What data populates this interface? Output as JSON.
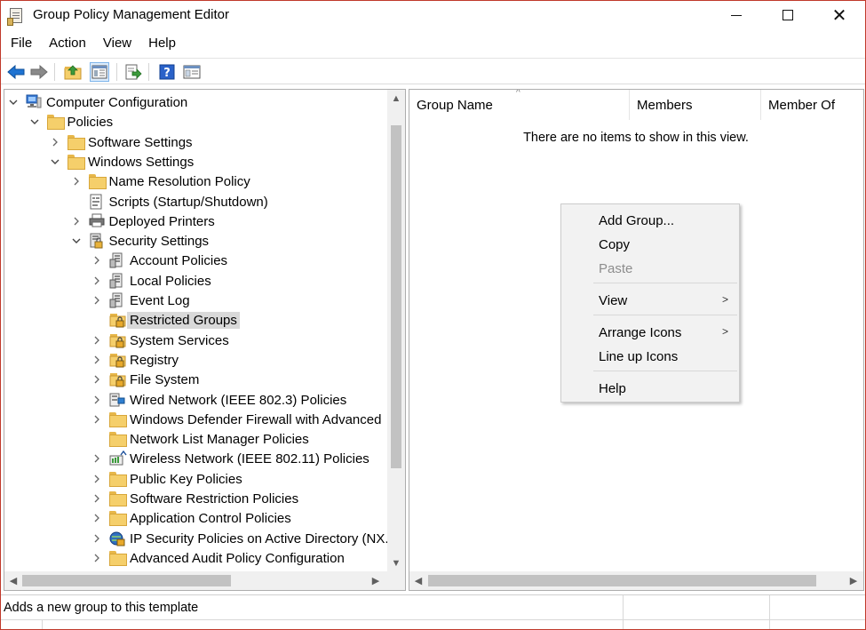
{
  "window": {
    "title": "Group Policy Management Editor",
    "close_glyph": "✕"
  },
  "menu": [
    "File",
    "Action",
    "View",
    "Help"
  ],
  "toolbar": {
    "icons": [
      "back-arrow-icon",
      "forward-arrow-icon",
      "up-folder-icon",
      "show-hide-console-tree-icon",
      "export-list-icon",
      "help-icon",
      "properties-icon"
    ],
    "accent": "#1e73d2"
  },
  "tree": {
    "items": [
      {
        "label": "Computer Configuration",
        "level": 0,
        "expander": "expanded",
        "icon": "computer-icon"
      },
      {
        "label": "Policies",
        "level": 1,
        "expander": "expanded",
        "icon": "folder-icon"
      },
      {
        "label": "Software Settings",
        "level": 2,
        "expander": "collapsed",
        "icon": "folder-icon"
      },
      {
        "label": "Windows Settings",
        "level": 2,
        "expander": "expanded",
        "icon": "folder-icon"
      },
      {
        "label": "Name Resolution Policy",
        "level": 3,
        "expander": "collapsed",
        "icon": "folder-icon"
      },
      {
        "label": "Scripts (Startup/Shutdown)",
        "level": 3,
        "expander": "none",
        "icon": "script-icon"
      },
      {
        "label": "Deployed Printers",
        "level": 3,
        "expander": "collapsed",
        "icon": "printer-icon"
      },
      {
        "label": "Security Settings",
        "level": 3,
        "expander": "expanded",
        "icon": "security-settings-icon"
      },
      {
        "label": "Account Policies",
        "level": 4,
        "expander": "collapsed",
        "icon": "policy-icon"
      },
      {
        "label": "Local Policies",
        "level": 4,
        "expander": "collapsed",
        "icon": "policy-icon"
      },
      {
        "label": "Event Log",
        "level": 4,
        "expander": "collapsed",
        "icon": "policy-icon"
      },
      {
        "label": "Restricted Groups",
        "level": 4,
        "expander": "none",
        "icon": "locked-folder-icon",
        "selected": true
      },
      {
        "label": "System Services",
        "level": 4,
        "expander": "collapsed",
        "icon": "locked-folder-icon"
      },
      {
        "label": "Registry",
        "level": 4,
        "expander": "collapsed",
        "icon": "locked-folder-icon"
      },
      {
        "label": "File System",
        "level": 4,
        "expander": "collapsed",
        "icon": "locked-folder-icon"
      },
      {
        "label": "Wired Network (IEEE 802.3) Policies",
        "level": 4,
        "expander": "collapsed",
        "icon": "network-icon"
      },
      {
        "label": "Windows Defender Firewall with Advanced",
        "level": 4,
        "expander": "collapsed",
        "icon": "folder-icon"
      },
      {
        "label": "Network List Manager Policies",
        "level": 4,
        "expander": "none",
        "icon": "folder-icon"
      },
      {
        "label": "Wireless Network (IEEE 802.11) Policies",
        "level": 4,
        "expander": "collapsed",
        "icon": "wireless-icon"
      },
      {
        "label": "Public Key Policies",
        "level": 4,
        "expander": "collapsed",
        "icon": "folder-icon"
      },
      {
        "label": "Software Restriction Policies",
        "level": 4,
        "expander": "collapsed",
        "icon": "folder-icon"
      },
      {
        "label": "Application Control Policies",
        "level": 4,
        "expander": "collapsed",
        "icon": "folder-icon"
      },
      {
        "label": "IP Security Policies on Active Directory (NX.",
        "level": 4,
        "expander": "collapsed",
        "icon": "ip-security-icon"
      },
      {
        "label": "Advanced Audit Policy Configuration",
        "level": 4,
        "expander": "collapsed",
        "icon": "folder-icon"
      }
    ]
  },
  "list": {
    "columns": [
      "Group Name",
      "Members",
      "Member Of"
    ],
    "empty_message": "There are no items to show in this view."
  },
  "context_menu": {
    "items": [
      {
        "label": "Add Group...",
        "enabled": true
      },
      {
        "label": "Copy",
        "enabled": true
      },
      {
        "label": "Paste",
        "enabled": false
      },
      {
        "label": "View",
        "enabled": true,
        "submenu": true
      },
      {
        "label": "Arrange Icons",
        "enabled": true,
        "submenu": true
      },
      {
        "label": "Line up Icons",
        "enabled": true
      },
      {
        "label": "Help",
        "enabled": true
      }
    ]
  },
  "status": {
    "text": "Adds a new group to this template"
  }
}
